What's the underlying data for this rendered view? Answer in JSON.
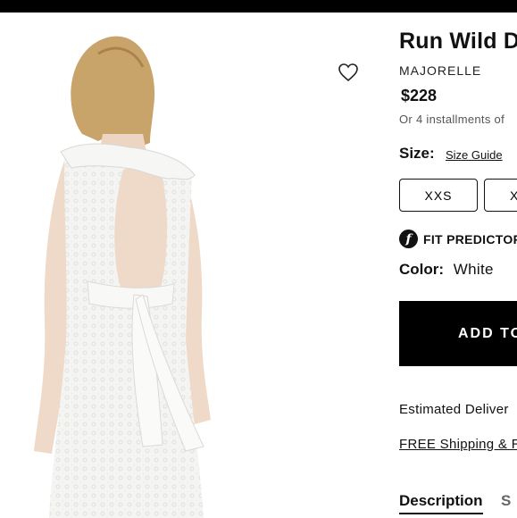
{
  "product": {
    "title": "Run Wild D",
    "brand": "MAJORELLE",
    "price": "$228",
    "installments": "Or 4 installments of"
  },
  "size": {
    "label": "Size:",
    "guide_link": "Size Guide",
    "options": [
      "XXS",
      "X"
    ]
  },
  "fit_predictor": {
    "icon_glyph": "f",
    "label": "FIT PREDICTOR"
  },
  "color": {
    "label": "Color:",
    "value": "White"
  },
  "cart": {
    "add_label": "ADD TO"
  },
  "delivery": {
    "estimated": "Estimated Deliver",
    "shipping_link": "FREE Shipping & R"
  },
  "tabs": [
    "Description",
    "S"
  ],
  "icons": {
    "wishlist": "heart-outline-icon",
    "fit": "fit-predictor-logo-icon"
  },
  "colors": {
    "accent": "#000000",
    "button_text": "#ffffff"
  }
}
